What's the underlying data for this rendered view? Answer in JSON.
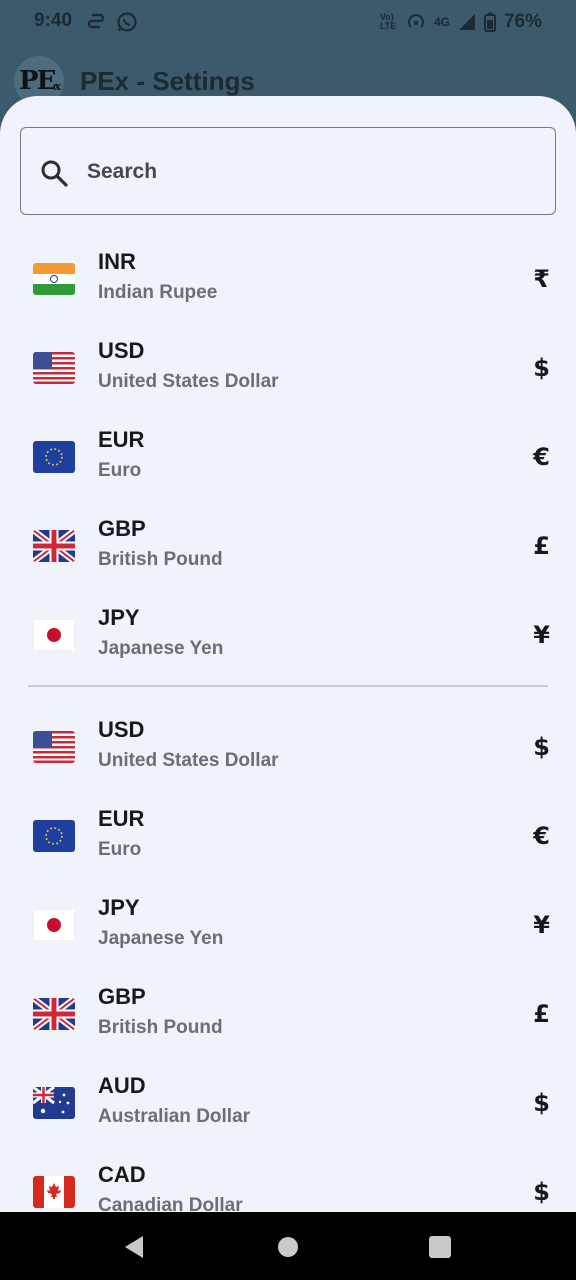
{
  "status_bar": {
    "time": "9:40",
    "battery": "76%",
    "network": "4G",
    "carrier_label": "Vo) LTE",
    "left_icons": [
      "sync-icon",
      "whatsapp-icon"
    ],
    "right_icons": [
      "volte-icon",
      "hotspot-icon",
      "signal-icon",
      "battery-icon"
    ]
  },
  "app": {
    "logo_text": "PE",
    "logo_sub": "x",
    "title": "PEx - Settings"
  },
  "search": {
    "placeholder": "Search",
    "value": ""
  },
  "popular_currencies": [
    {
      "code": "INR",
      "name": "Indian Rupee",
      "symbol": "₹",
      "flag": "india-flag"
    },
    {
      "code": "USD",
      "name": "United States Dollar",
      "symbol": "$",
      "flag": "usa-flag"
    },
    {
      "code": "EUR",
      "name": "Euro",
      "symbol": "€",
      "flag": "eu-flag"
    },
    {
      "code": "GBP",
      "name": "British Pound",
      "symbol": "£",
      "flag": "uk-flag"
    },
    {
      "code": "JPY",
      "name": "Japanese Yen",
      "symbol": "¥",
      "flag": "japan-flag"
    }
  ],
  "all_currencies": [
    {
      "code": "USD",
      "name": "United States Dollar",
      "symbol": "$",
      "flag": "usa-flag"
    },
    {
      "code": "EUR",
      "name": "Euro",
      "symbol": "€",
      "flag": "eu-flag"
    },
    {
      "code": "JPY",
      "name": "Japanese Yen",
      "symbol": "¥",
      "flag": "japan-flag"
    },
    {
      "code": "GBP",
      "name": "British Pound",
      "symbol": "£",
      "flag": "uk-flag"
    },
    {
      "code": "AUD",
      "name": "Australian Dollar",
      "symbol": "$",
      "flag": "australia-flag"
    },
    {
      "code": "CAD",
      "name": "Canadian Dollar",
      "symbol": "$",
      "flag": "canada-flag"
    }
  ],
  "nav_bar": {
    "buttons": [
      "back-icon",
      "home-icon",
      "recents-icon"
    ]
  },
  "colors": {
    "header_bg": "#3d5a6c",
    "sheet_bg": "#f0f3fa",
    "text_primary": "#16191c",
    "text_secondary": "#6b6f75"
  }
}
